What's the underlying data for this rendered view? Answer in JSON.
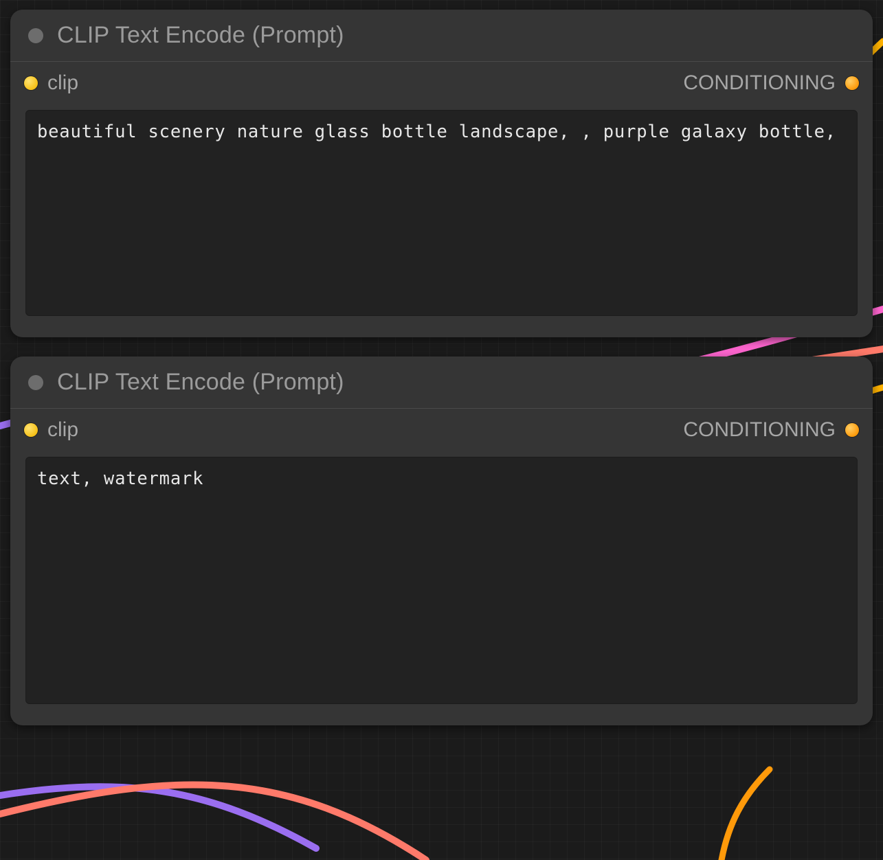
{
  "colors": {
    "port_input": "#f6c017",
    "port_output": "#ff9a0a",
    "cable_yellow": "#ffb300",
    "cable_purple": "#9a6ef0",
    "cable_pink": "#ff66d0",
    "cable_salmon": "#ff7a6a"
  },
  "nodes": [
    {
      "title": "CLIP Text Encode (Prompt)",
      "inputs": [
        {
          "name": "clip",
          "label": "clip",
          "color": "yellow"
        }
      ],
      "outputs": [
        {
          "name": "conditioning",
          "label": "CONDITIONING",
          "color": "orange"
        }
      ],
      "prompt_value": "beautiful scenery nature glass bottle landscape, , purple galaxy bottle,"
    },
    {
      "title": "CLIP Text Encode (Prompt)",
      "inputs": [
        {
          "name": "clip",
          "label": "clip",
          "color": "yellow"
        }
      ],
      "outputs": [
        {
          "name": "conditioning",
          "label": "CONDITIONING",
          "color": "orange"
        }
      ],
      "prompt_value": "text, watermark"
    }
  ]
}
